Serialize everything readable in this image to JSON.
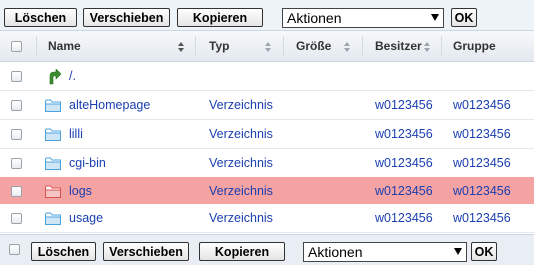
{
  "toolbar": {
    "delete_label": "Löschen",
    "move_label": "Verschieben",
    "copy_label": "Kopieren",
    "actions_selected": "Aktionen",
    "ok_label": "OK"
  },
  "table": {
    "columns": [
      "Name",
      "Typ",
      "Größe",
      "Besitzer",
      "Gruppe"
    ],
    "parent_link": "/.",
    "rows": [
      {
        "name": "alteHomepage",
        "type": "Verzeichnis",
        "size": "",
        "owner": "w0123456",
        "group": "w0123456",
        "selected": false
      },
      {
        "name": "lilli",
        "type": "Verzeichnis",
        "size": "",
        "owner": "w0123456",
        "group": "w0123456",
        "selected": false
      },
      {
        "name": "cgi-bin",
        "type": "Verzeichnis",
        "size": "",
        "owner": "w0123456",
        "group": "w0123456",
        "selected": false
      },
      {
        "name": "logs",
        "type": "Verzeichnis",
        "size": "",
        "owner": "w0123456",
        "group": "w0123456",
        "selected": true
      },
      {
        "name": "usage",
        "type": "Verzeichnis",
        "size": "",
        "owner": "w0123456",
        "group": "w0123456",
        "selected": false
      }
    ]
  },
  "colors": {
    "selected_row": "#f4a2a2",
    "link": "#1a3fb0",
    "folder_blue": "#4aa3df",
    "folder_red": "#d9534f"
  }
}
